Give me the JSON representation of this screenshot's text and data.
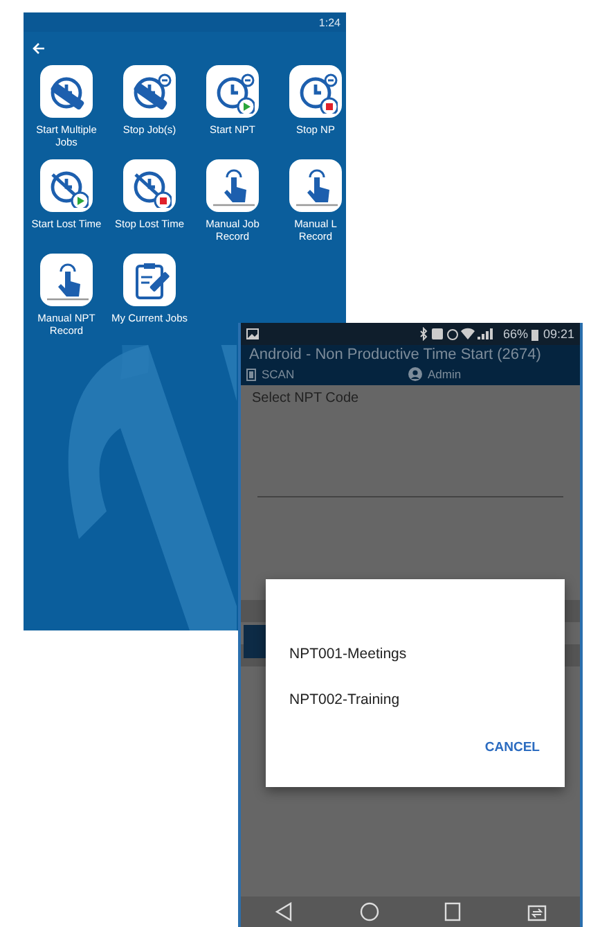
{
  "menu_screen": {
    "status_time": "1:24",
    "tiles": [
      {
        "label": "Start Multiple Jobs",
        "kind": "job-start"
      },
      {
        "label": "Stop Job(s)",
        "kind": "job-stop"
      },
      {
        "label": "Start NPT",
        "kind": "clock-play"
      },
      {
        "label": "Stop NP",
        "kind": "clock-stop"
      },
      {
        "label": "Start Lost Time",
        "kind": "lost-play"
      },
      {
        "label": "Stop Lost Time",
        "kind": "lost-stop"
      },
      {
        "label": "Manual Job Record",
        "kind": "touch"
      },
      {
        "label": "Manual L Record",
        "kind": "touch"
      },
      {
        "label": "Manual NPT Record",
        "kind": "touch"
      },
      {
        "label": "My Current Jobs",
        "kind": "clipboard"
      }
    ]
  },
  "dialog_screen": {
    "status": {
      "battery": "66%",
      "time": "09:21"
    },
    "title": "Android - Non Productive Time Start (2674)",
    "toolbar": {
      "scan": "SCAN",
      "user": "Admin"
    },
    "field_label": "Select NPT Code",
    "dialog": {
      "options": [
        "NPT001-Meetings",
        "NPT002-Training"
      ],
      "cancel": "CANCEL"
    }
  }
}
